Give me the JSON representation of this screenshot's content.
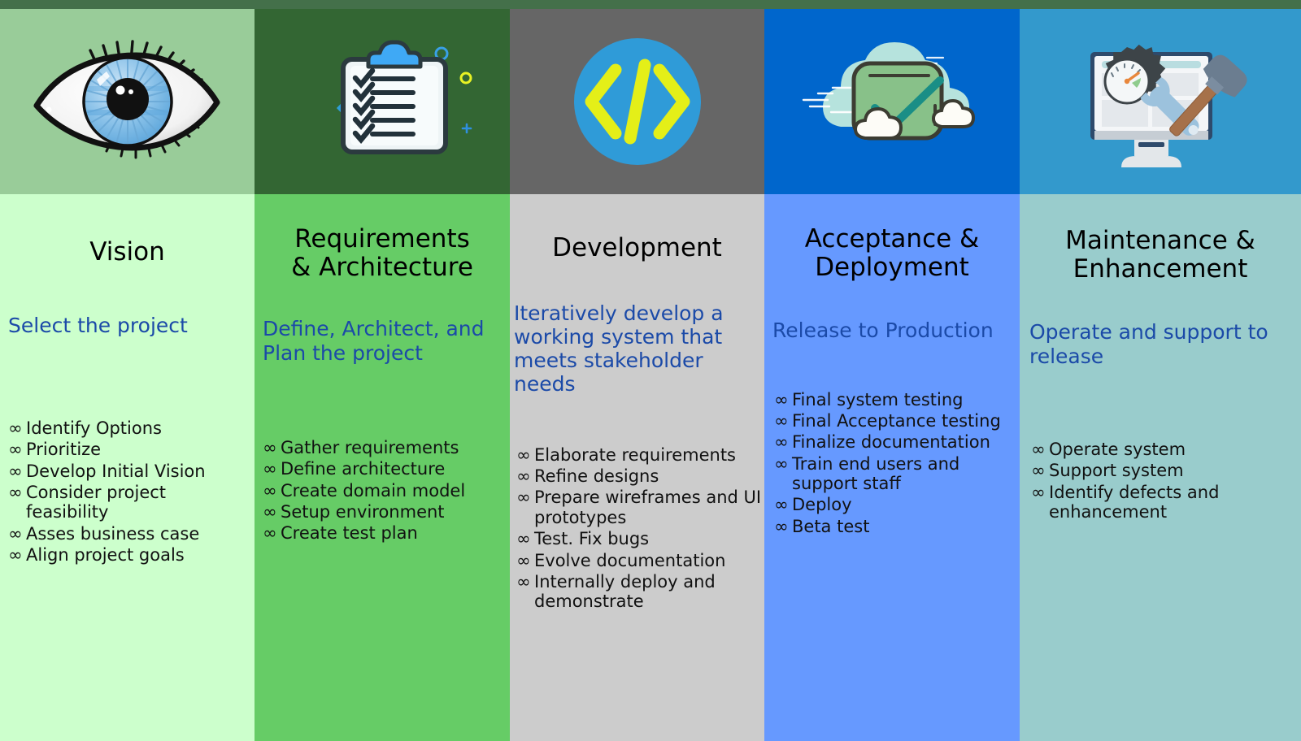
{
  "top_strip_color": "#44704a",
  "stages": [
    {
      "id": "vision",
      "title": "Vision",
      "subtitle": "Select the project",
      "icon": "eye-icon",
      "header_color": "#99CC99",
      "body_color": "#CCFFCC",
      "title_color": "#000000",
      "subtitle_color": "#1b4aa8",
      "bullet_mark": "∞",
      "bullets": [
        "Identify Options",
        "Prioritize",
        "Develop Initial Vision",
        "Consider project feasibility",
        "Asses business case",
        "Align project goals"
      ]
    },
    {
      "id": "requirements-architecture",
      "title": "Requirements\n& Architecture",
      "subtitle": "Define, Architect, and Plan the project",
      "icon": "clipboard-checklist-icon",
      "header_color": "#336633",
      "body_color": "#66CC66",
      "title_color": "#000000",
      "subtitle_color": "#1b4aa8",
      "bullet_mark": "∞",
      "bullets": [
        "Gather requirements",
        "Define architecture",
        "Create domain model",
        "Setup environment",
        "Create test plan"
      ]
    },
    {
      "id": "development",
      "title": "Development",
      "subtitle": "Iteratively develop a working system that meets stakeholder needs",
      "icon": "code-brackets-icon",
      "header_color": "#666666",
      "body_color": "#CCCCCC",
      "title_color": "#000000",
      "subtitle_color": "#1b4aa8",
      "bullet_mark": "∞",
      "bullets": [
        "Elaborate requirements",
        "Refine designs",
        "Prepare wireframes and UI prototypes",
        "Test. Fix bugs",
        "Evolve documentation",
        "Internally deploy and demonstrate"
      ]
    },
    {
      "id": "acceptance-deployment",
      "title": "Acceptance &\nDeployment",
      "subtitle": "Release to Production",
      "icon": "cloud-check-icon",
      "header_color": "#0066CC",
      "body_color": "#6699FF",
      "title_color": "#000000",
      "subtitle_color": "#1b4aa8",
      "bullet_mark": "∞",
      "bullets": [
        "Final system testing",
        "Final Acceptance testing",
        "Finalize documentation",
        "Train end users and support staff",
        "Deploy",
        "Beta test"
      ]
    },
    {
      "id": "maintenance-enhancement",
      "title": "Maintenance &\nEnhancement",
      "subtitle": "Operate and support to release",
      "icon": "monitor-tools-icon",
      "header_color": "#3399CC",
      "body_color": "#99CCCC",
      "title_color": "#000000",
      "subtitle_color": "#1b4aa8",
      "bullet_mark": "∞",
      "bullets": [
        "Operate system",
        "Support system",
        "Identify defects and enhancement"
      ]
    }
  ]
}
